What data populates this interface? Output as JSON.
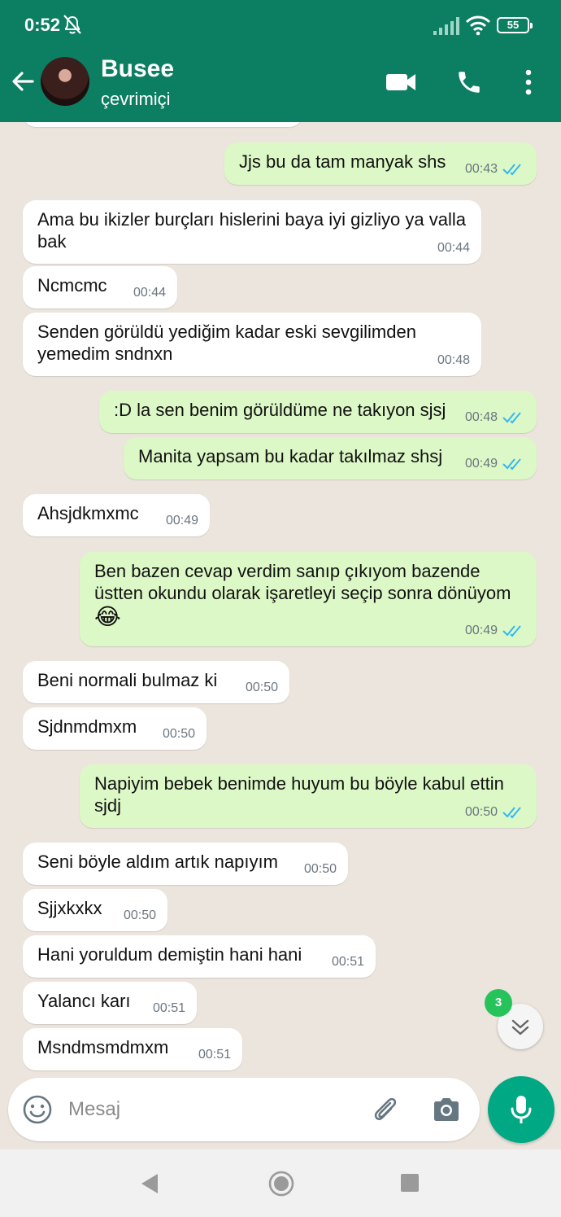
{
  "status_bar": {
    "time": "0:52",
    "battery": "55",
    "icons": [
      "mute-icon",
      "signal-icon",
      "wifi-icon",
      "battery-icon"
    ]
  },
  "header": {
    "contact_name": "Busee",
    "contact_status": "çevrimiçi",
    "icons": [
      "back-arrow-icon",
      "video-call-icon",
      "voice-call-icon",
      "more-options-icon"
    ],
    "bg_color": "#0c7e62"
  },
  "messages": [
    {
      "dir": "out",
      "text": "Jjs bu da tam manyak shs",
      "time": "00:43",
      "read": true
    },
    {
      "dir": "in",
      "text": "Ama bu ikizler burçları hislerini baya iyi gizliyo ya valla bak",
      "time": "00:44"
    },
    {
      "dir": "in",
      "text": "Ncmcmc",
      "time": "00:44"
    },
    {
      "dir": "in",
      "text": "Senden görüldü yediğim kadar eski sevgilimden yemedim sndnxn",
      "time": "00:48"
    },
    {
      "dir": "out",
      "text": ":D la sen benim görüldüme ne takıyon sjsj",
      "time": "00:48",
      "read": true
    },
    {
      "dir": "out",
      "text": "Manita yapsam bu kadar takılmaz shsj",
      "time": "00:49",
      "read": true
    },
    {
      "dir": "in",
      "text": "Ahsjdkmxmc",
      "time": "00:49"
    },
    {
      "dir": "out",
      "text": "Ben bazen cevap verdim sanıp çıkıyom bazende üstten okundu olarak işaretleyi seçip sonra dönüyom",
      "emoji": "😂",
      "time": "00:49",
      "read": true
    },
    {
      "dir": "in",
      "text": "Beni normali bulmaz ki",
      "time": "00:50"
    },
    {
      "dir": "in",
      "text": "Sjdnmdmxm",
      "time": "00:50"
    },
    {
      "dir": "out",
      "text": "Napiyim bebek benimde huyum bu böyle kabul ettin sjdj",
      "time": "00:50",
      "read": true
    },
    {
      "dir": "in",
      "text": "Seni böyle aldım artık napıyım",
      "time": "00:50"
    },
    {
      "dir": "in",
      "text": "Sjjxkxkx",
      "time": "00:50"
    },
    {
      "dir": "in",
      "text": "Hani yoruldum demiştin hani hani",
      "time": "00:51"
    },
    {
      "dir": "in",
      "text": "Yalancı karı",
      "time": "00:51"
    },
    {
      "dir": "in",
      "text": "Msndmsmdmxm",
      "time": "00:51"
    }
  ],
  "scroll_down": {
    "unread_count": "3"
  },
  "composer": {
    "placeholder": "Mesaj",
    "icons": [
      "emoji-icon",
      "attach-icon",
      "camera-icon",
      "mic-icon"
    ]
  },
  "colors": {
    "incoming_bubble": "#ffffff",
    "outgoing_bubble": "#dcf8c6",
    "read_ticks": "#34b7f1",
    "chat_bg": "#ece5dd",
    "mic_button": "#00a884"
  },
  "nav_bar": {
    "icons": [
      "nav-back-icon",
      "nav-home-icon",
      "nav-recents-icon"
    ]
  }
}
